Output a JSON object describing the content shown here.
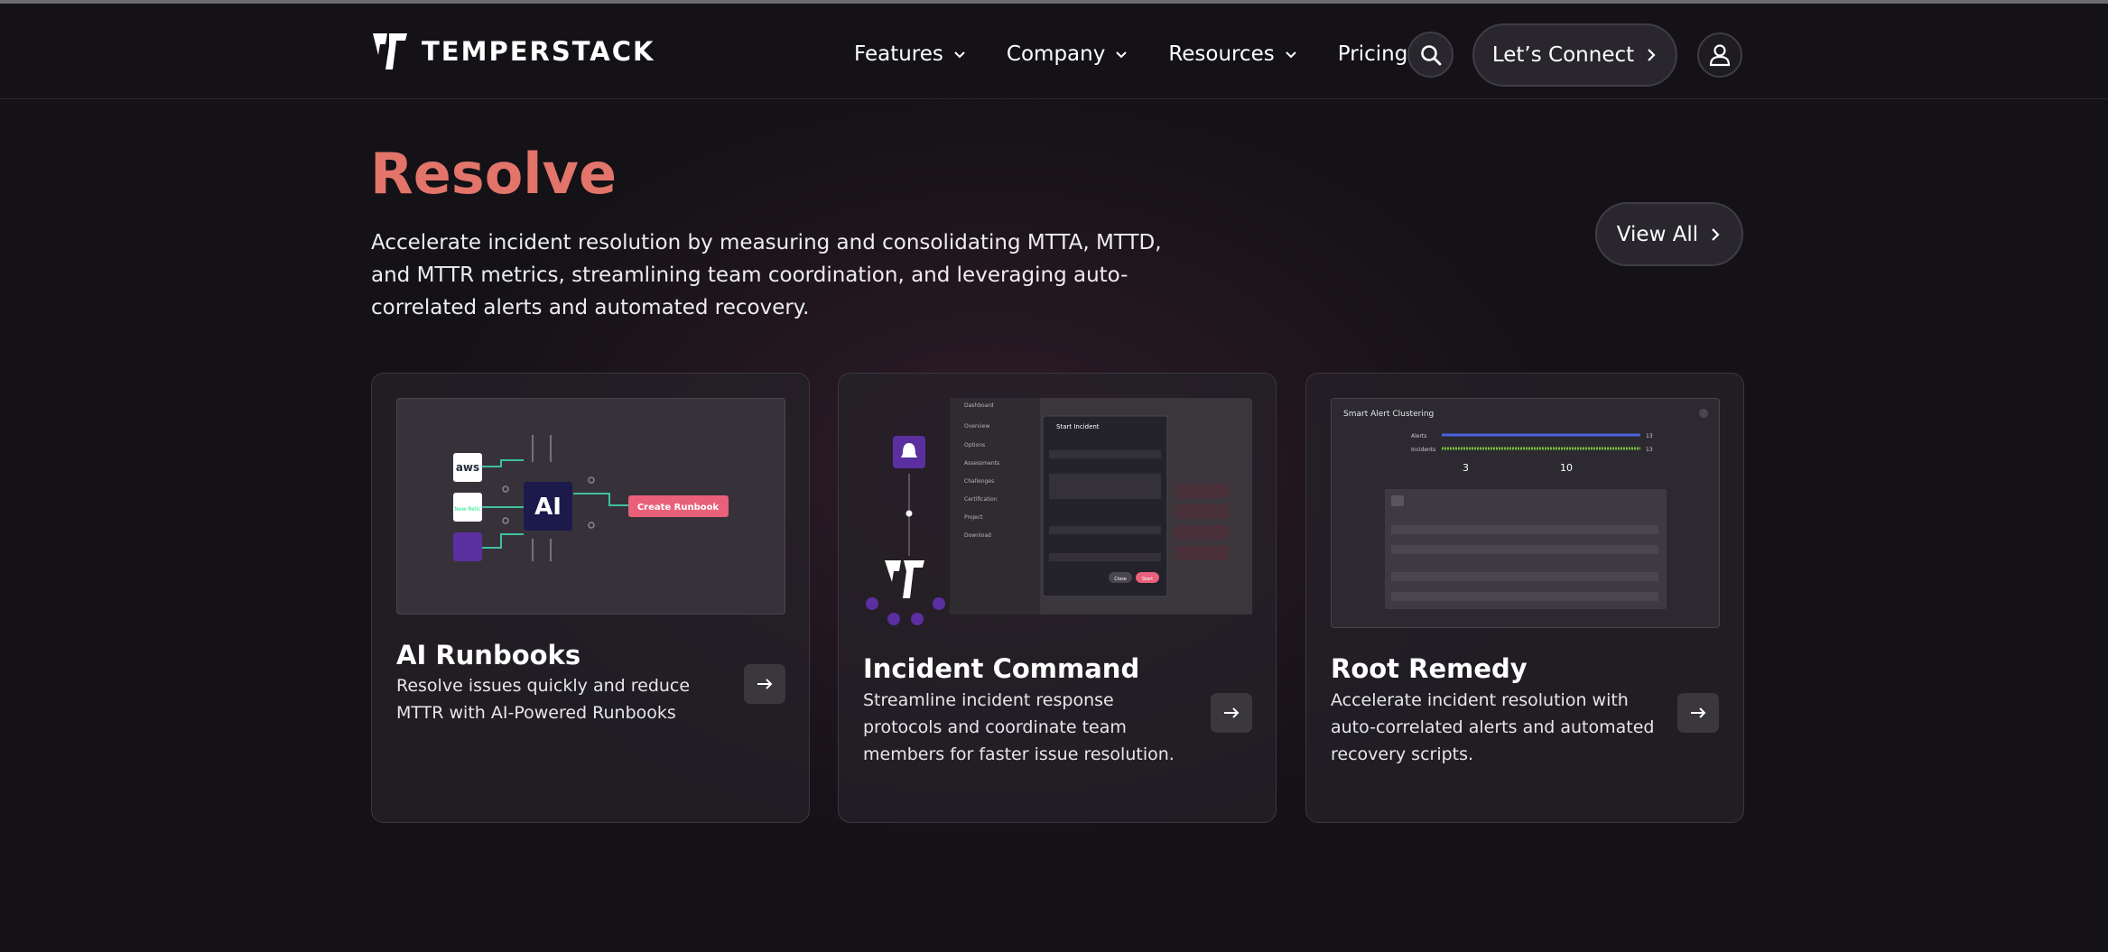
{
  "brand": {
    "name": "TEMPERSTACK"
  },
  "nav": {
    "items": [
      {
        "label": "Features",
        "has_dropdown": true
      },
      {
        "label": "Company",
        "has_dropdown": true
      },
      {
        "label": "Resources",
        "has_dropdown": true
      },
      {
        "label": "Pricing",
        "has_dropdown": false
      }
    ],
    "search_icon": "search-icon",
    "connect_label": "Let’s Connect",
    "user_icon": "user-icon"
  },
  "hero": {
    "title": "Resolve",
    "description": "Accelerate incident resolution by measuring and consolidating MTTA, MTTD, and MTTR metrics, streamlining team coordination, and leveraging auto-correlated alerts and automated recovery.",
    "view_all_label": "View All"
  },
  "cards": [
    {
      "title": "AI Runbooks",
      "description": "Resolve issues quickly and reduce MTTR with AI-Powered Runbooks",
      "illustration": {
        "ai_label": "AI",
        "aws_label": "aws",
        "newrelic_label": "New Relic",
        "button_label": "Create Runbook"
      }
    },
    {
      "title": "Incident Command",
      "description": "Streamline incident response protocols and coordinate team members for faster issue resolution.",
      "illustration": {
        "dialog_title": "Start Incident",
        "sidebar_items": [
          "Dashboard",
          "Overview",
          "Options",
          "Assessments",
          "Challenges",
          "Certification",
          "Project",
          "Download"
        ],
        "close_label": "Close",
        "start_label": "Start"
      }
    },
    {
      "title": "Root Remedy",
      "description": "Accelerate incident resolution with auto-correlated alerts and automated recovery scripts.",
      "illustration": {
        "panel_title": "Smart Alert Clustering",
        "alerts_label": "Alerts",
        "incidents_label": "Incidents",
        "alerts_count": "13",
        "incidents_count": "13",
        "stat_a": "3",
        "stat_b": "10"
      }
    }
  ],
  "colors": {
    "accent": "#e2746a",
    "background": "#141217",
    "button_pink": "#e8607a",
    "purple": "#5b2fa0"
  }
}
